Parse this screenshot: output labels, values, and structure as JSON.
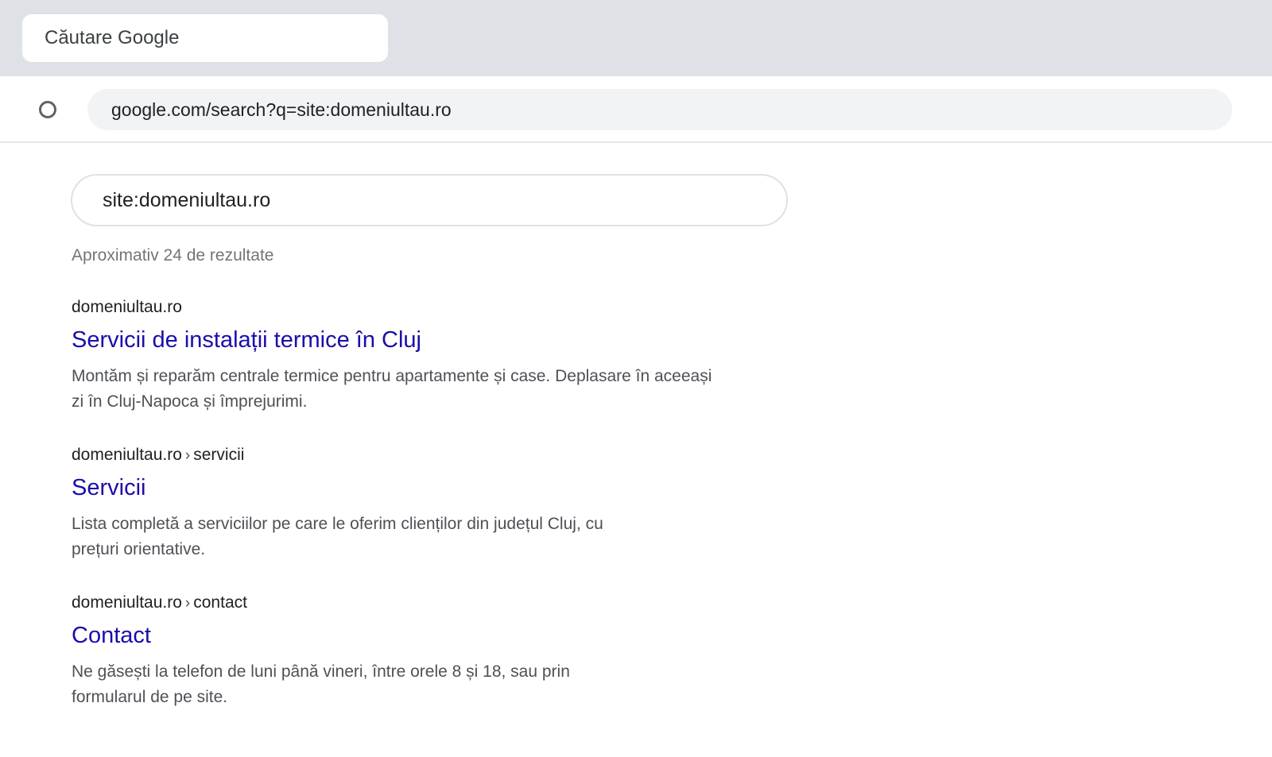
{
  "browser": {
    "tab_title": "Căutare Google",
    "address": "google.com/search?q=site:domeniultau.ro"
  },
  "search": {
    "query": "site:domeniultau.ro",
    "result_stats": "Aproximativ 24 de rezultate"
  },
  "results": [
    {
      "site": "domeniultau.ro",
      "path": "",
      "title": "Servicii de instalații termice în Cluj",
      "snippet": "Montăm și reparăm centrale termice pentru apartamente și case. Deplasare în aceeași zi în Cluj-Napoca și împrejurimi."
    },
    {
      "site": "domeniultau.ro",
      "path": "servicii",
      "title": "Servicii",
      "snippet": "Lista completă a serviciilor pe care le oferim clienților din județul Cluj, cu prețuri orientative."
    },
    {
      "site": "domeniultau.ro",
      "path": "contact",
      "title": "Contact",
      "snippet": "Ne găsești la telefon de luni până vineri, între orele 8 și 18, sau prin formularul de pe site."
    }
  ],
  "colors": {
    "link": "#1a0dab",
    "tabstrip": "#dee1e6",
    "omnibox": "#f1f3f4"
  },
  "icons": {
    "reload": "reload-icon"
  }
}
